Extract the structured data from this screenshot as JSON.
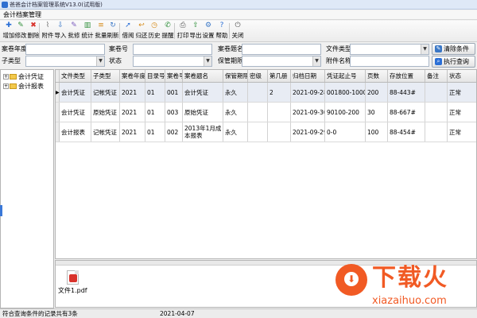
{
  "window": {
    "title": "爸爸会计档案管理系统V13.0(试用版)"
  },
  "menu": {
    "title": "会计档案管理"
  },
  "toolbar": {
    "items": [
      {
        "label": "增加",
        "icon": "add-icon",
        "color": "#2b6fd6",
        "glyph": "✚"
      },
      {
        "label": "修改",
        "icon": "edit-icon",
        "color": "#2f8f3a",
        "glyph": "✎"
      },
      {
        "label": "删除",
        "icon": "delete-icon",
        "color": "#d8322b",
        "glyph": "✖"
      },
      {
        "label": "附件",
        "icon": "paperclip-icon",
        "color": "#6a6a6a",
        "glyph": "⌇"
      },
      {
        "label": "导入",
        "icon": "import-icon",
        "color": "#3a77c6",
        "glyph": "⇩"
      },
      {
        "label": "批修",
        "icon": "batch-edit-icon",
        "color": "#7a5bbd",
        "glyph": "✎"
      },
      {
        "label": "统计",
        "icon": "statistics-icon",
        "color": "#2f8f3a",
        "glyph": "▥"
      },
      {
        "label": "批量",
        "icon": "batch-icon",
        "color": "#d58a18",
        "glyph": "≡"
      },
      {
        "label": "刷新",
        "icon": "refresh-icon",
        "color": "#3a77c6",
        "glyph": "↻"
      },
      {
        "label": "借阅",
        "icon": "borrow-icon",
        "color": "#2b6fd6",
        "glyph": "➚"
      },
      {
        "label": "归还",
        "icon": "return-icon",
        "color": "#d58a18",
        "glyph": "↩"
      },
      {
        "label": "历史",
        "icon": "history-icon",
        "color": "#d58a18",
        "glyph": "◷"
      },
      {
        "label": "提醒",
        "icon": "reminder-icon",
        "color": "#2f8f3a",
        "glyph": "✆"
      },
      {
        "label": "打印",
        "icon": "print-icon",
        "color": "#555555",
        "glyph": "⎙"
      },
      {
        "label": "导出",
        "icon": "export-icon",
        "color": "#2f8f3a",
        "glyph": "⇧"
      },
      {
        "label": "设置",
        "icon": "settings-icon",
        "color": "#3a77c6",
        "glyph": "⚙"
      },
      {
        "label": "帮助",
        "icon": "help-icon",
        "color": "#2b6fd6",
        "glyph": "?"
      },
      {
        "label": "关闭",
        "icon": "close-icon",
        "color": "#555555",
        "glyph": "⏻"
      }
    ]
  },
  "filters": {
    "archive_year": {
      "label": "案卷年度",
      "value": ""
    },
    "volume_no": {
      "label": "案卷号",
      "value": ""
    },
    "volume_title": {
      "label": "案卷题名",
      "value": ""
    },
    "file_type": {
      "label": "文件类型",
      "value": ""
    },
    "sub_type": {
      "label": "子类型",
      "value": ""
    },
    "status": {
      "label": "状态",
      "value": ""
    },
    "retention": {
      "label": "保管期限",
      "value": ""
    },
    "attachment_name": {
      "label": "附件名称",
      "value": ""
    },
    "clear_button": "清除条件",
    "query_button": "执行查询"
  },
  "tree": {
    "items": [
      {
        "label": "会计凭证"
      },
      {
        "label": "会计报表"
      }
    ]
  },
  "table": {
    "columns": [
      "文件类型",
      "子类型",
      "案卷年度",
      "目录号",
      "案卷号",
      "案卷题名",
      "保管期限",
      "密级",
      "第几册",
      "归档日期",
      "凭证起止号",
      "页数",
      "存放位置",
      "备注",
      "状态"
    ],
    "rows": [
      [
        "会计凭证",
        "记帐凭证",
        "2021",
        "01",
        "001",
        "会计凭证",
        "永久",
        "",
        "2",
        "2021-09-28",
        "001800-1000",
        "200",
        "88-443#",
        "",
        "正常"
      ],
      [
        "会计凭证",
        "原始凭证",
        "2021",
        "01",
        "003",
        "原始凭证",
        "永久",
        "",
        "",
        "2021-09-30",
        "90100-200",
        "30",
        "88-667#",
        "",
        "正常"
      ],
      [
        "会计报表",
        "记帐凭证",
        "2021",
        "01",
        "002",
        "2013年1月成本报表",
        "永久",
        "",
        "",
        "2021-09-29",
        "0-0",
        "100",
        "88-454#",
        "",
        "正常"
      ]
    ]
  },
  "attachments": [
    {
      "name": "文件1.pdf"
    }
  ],
  "watermark": {
    "big": "下载火",
    "small": "xiazaihuo.com"
  },
  "statusbar": {
    "count_text": "符合查询条件的记录共有3条",
    "date": "2021-04-07"
  }
}
